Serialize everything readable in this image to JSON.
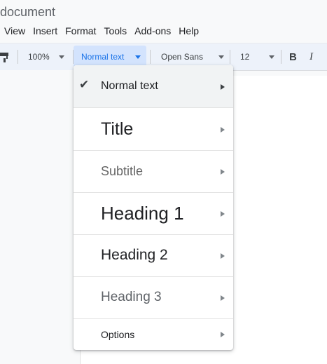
{
  "doc": {
    "title": "document"
  },
  "menubar": [
    "View",
    "Insert",
    "Format",
    "Tools",
    "Add-ons",
    "Help"
  ],
  "toolbar": {
    "zoom": "100%",
    "style": "Normal text",
    "font": "Open Sans",
    "size": "12",
    "bold": "B",
    "italic": "I"
  },
  "style_menu": {
    "items": [
      {
        "label": "Normal text",
        "checked": true
      },
      {
        "label": "Title"
      },
      {
        "label": "Subtitle"
      },
      {
        "label": "Heading 1"
      },
      {
        "label": "Heading 2"
      },
      {
        "label": "Heading 3"
      },
      {
        "label": "Options"
      }
    ],
    "check_icon": "✔"
  },
  "colors": {
    "accent": "#1a73e8",
    "selected_bg": "#f1f3f4",
    "toolbar_bg": "#edf2fa"
  }
}
